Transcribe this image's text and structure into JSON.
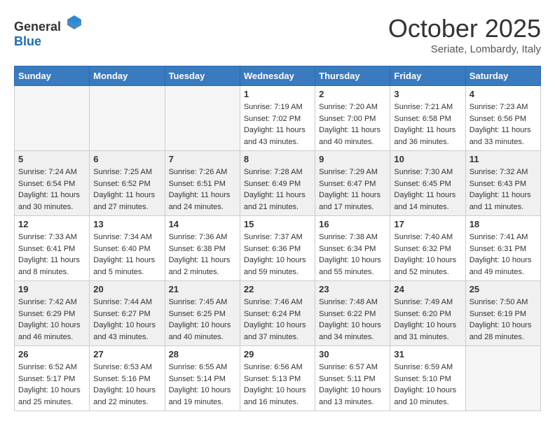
{
  "logo": {
    "general": "General",
    "blue": "Blue"
  },
  "title": "October 2025",
  "subtitle": "Seriate, Lombardy, Italy",
  "weekdays": [
    "Sunday",
    "Monday",
    "Tuesday",
    "Wednesday",
    "Thursday",
    "Friday",
    "Saturday"
  ],
  "weeks": [
    [
      {
        "day": "",
        "info": ""
      },
      {
        "day": "",
        "info": ""
      },
      {
        "day": "",
        "info": ""
      },
      {
        "day": "1",
        "info": "Sunrise: 7:19 AM\nSunset: 7:02 PM\nDaylight: 11 hours and 43 minutes."
      },
      {
        "day": "2",
        "info": "Sunrise: 7:20 AM\nSunset: 7:00 PM\nDaylight: 11 hours and 40 minutes."
      },
      {
        "day": "3",
        "info": "Sunrise: 7:21 AM\nSunset: 6:58 PM\nDaylight: 11 hours and 36 minutes."
      },
      {
        "day": "4",
        "info": "Sunrise: 7:23 AM\nSunset: 6:56 PM\nDaylight: 11 hours and 33 minutes."
      }
    ],
    [
      {
        "day": "5",
        "info": "Sunrise: 7:24 AM\nSunset: 6:54 PM\nDaylight: 11 hours and 30 minutes."
      },
      {
        "day": "6",
        "info": "Sunrise: 7:25 AM\nSunset: 6:52 PM\nDaylight: 11 hours and 27 minutes."
      },
      {
        "day": "7",
        "info": "Sunrise: 7:26 AM\nSunset: 6:51 PM\nDaylight: 11 hours and 24 minutes."
      },
      {
        "day": "8",
        "info": "Sunrise: 7:28 AM\nSunset: 6:49 PM\nDaylight: 11 hours and 21 minutes."
      },
      {
        "day": "9",
        "info": "Sunrise: 7:29 AM\nSunset: 6:47 PM\nDaylight: 11 hours and 17 minutes."
      },
      {
        "day": "10",
        "info": "Sunrise: 7:30 AM\nSunset: 6:45 PM\nDaylight: 11 hours and 14 minutes."
      },
      {
        "day": "11",
        "info": "Sunrise: 7:32 AM\nSunset: 6:43 PM\nDaylight: 11 hours and 11 minutes."
      }
    ],
    [
      {
        "day": "12",
        "info": "Sunrise: 7:33 AM\nSunset: 6:41 PM\nDaylight: 11 hours and 8 minutes."
      },
      {
        "day": "13",
        "info": "Sunrise: 7:34 AM\nSunset: 6:40 PM\nDaylight: 11 hours and 5 minutes."
      },
      {
        "day": "14",
        "info": "Sunrise: 7:36 AM\nSunset: 6:38 PM\nDaylight: 11 hours and 2 minutes."
      },
      {
        "day": "15",
        "info": "Sunrise: 7:37 AM\nSunset: 6:36 PM\nDaylight: 10 hours and 59 minutes."
      },
      {
        "day": "16",
        "info": "Sunrise: 7:38 AM\nSunset: 6:34 PM\nDaylight: 10 hours and 55 minutes."
      },
      {
        "day": "17",
        "info": "Sunrise: 7:40 AM\nSunset: 6:32 PM\nDaylight: 10 hours and 52 minutes."
      },
      {
        "day": "18",
        "info": "Sunrise: 7:41 AM\nSunset: 6:31 PM\nDaylight: 10 hours and 49 minutes."
      }
    ],
    [
      {
        "day": "19",
        "info": "Sunrise: 7:42 AM\nSunset: 6:29 PM\nDaylight: 10 hours and 46 minutes."
      },
      {
        "day": "20",
        "info": "Sunrise: 7:44 AM\nSunset: 6:27 PM\nDaylight: 10 hours and 43 minutes."
      },
      {
        "day": "21",
        "info": "Sunrise: 7:45 AM\nSunset: 6:25 PM\nDaylight: 10 hours and 40 minutes."
      },
      {
        "day": "22",
        "info": "Sunrise: 7:46 AM\nSunset: 6:24 PM\nDaylight: 10 hours and 37 minutes."
      },
      {
        "day": "23",
        "info": "Sunrise: 7:48 AM\nSunset: 6:22 PM\nDaylight: 10 hours and 34 minutes."
      },
      {
        "day": "24",
        "info": "Sunrise: 7:49 AM\nSunset: 6:20 PM\nDaylight: 10 hours and 31 minutes."
      },
      {
        "day": "25",
        "info": "Sunrise: 7:50 AM\nSunset: 6:19 PM\nDaylight: 10 hours and 28 minutes."
      }
    ],
    [
      {
        "day": "26",
        "info": "Sunrise: 6:52 AM\nSunset: 5:17 PM\nDaylight: 10 hours and 25 minutes."
      },
      {
        "day": "27",
        "info": "Sunrise: 6:53 AM\nSunset: 5:16 PM\nDaylight: 10 hours and 22 minutes."
      },
      {
        "day": "28",
        "info": "Sunrise: 6:55 AM\nSunset: 5:14 PM\nDaylight: 10 hours and 19 minutes."
      },
      {
        "day": "29",
        "info": "Sunrise: 6:56 AM\nSunset: 5:13 PM\nDaylight: 10 hours and 16 minutes."
      },
      {
        "day": "30",
        "info": "Sunrise: 6:57 AM\nSunset: 5:11 PM\nDaylight: 10 hours and 13 minutes."
      },
      {
        "day": "31",
        "info": "Sunrise: 6:59 AM\nSunset: 5:10 PM\nDaylight: 10 hours and 10 minutes."
      },
      {
        "day": "",
        "info": ""
      }
    ]
  ]
}
